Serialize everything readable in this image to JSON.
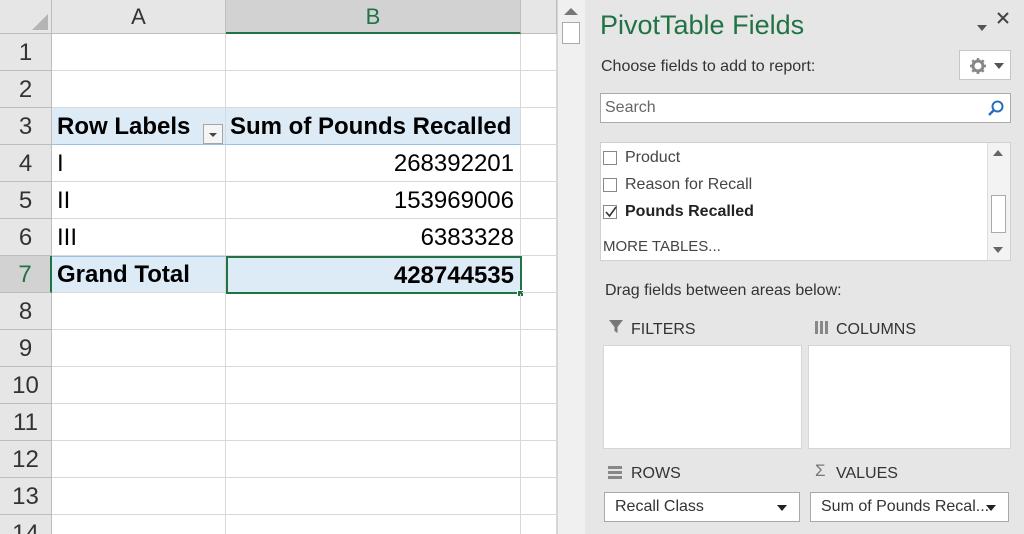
{
  "sheet": {
    "columns": [
      "A",
      "B"
    ],
    "row_numbers": [
      "1",
      "2",
      "3",
      "4",
      "5",
      "6",
      "7",
      "8",
      "9",
      "10",
      "11",
      "12",
      "13",
      "14"
    ],
    "header": {
      "a": "Row Labels",
      "b": "Sum of Pounds Recalled"
    },
    "rows": [
      {
        "label": "I",
        "value": "268392201"
      },
      {
        "label": "II",
        "value": "153969006"
      },
      {
        "label": "III",
        "value": "6383328"
      }
    ],
    "total": {
      "label": "Grand Total",
      "value": "428744535"
    }
  },
  "pivot": {
    "title": "PivotTable Fields",
    "choose_text": "Choose fields to add to report:",
    "search_placeholder": "Search",
    "fields": [
      {
        "label": "Product",
        "checked": false
      },
      {
        "label": "Reason for Recall",
        "checked": false
      },
      {
        "label": "Pounds Recalled",
        "checked": true
      }
    ],
    "more_tables": "MORE TABLES...",
    "drag_text": "Drag fields between areas below:",
    "areas": {
      "filters": "FILTERS",
      "columns": "COLUMNS",
      "rows": "ROWS",
      "values": "VALUES"
    },
    "rows_chip": "Recall Class",
    "values_chip": "Sum of Pounds Recal..."
  }
}
